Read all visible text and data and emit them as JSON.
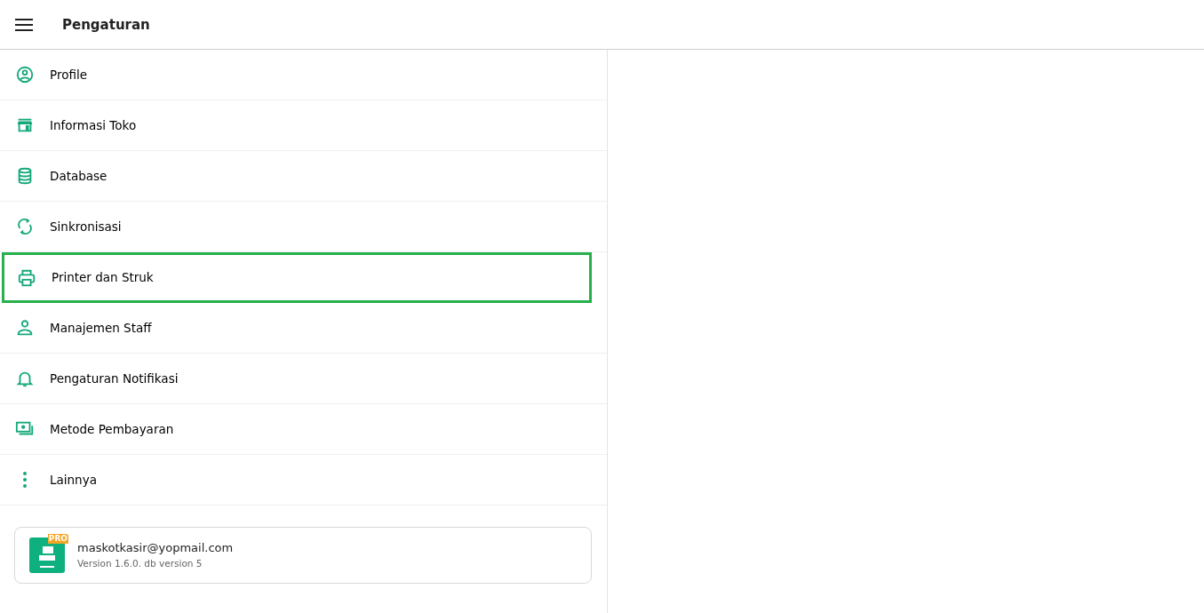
{
  "app_bar": {
    "title": "Pengaturan"
  },
  "menu": [
    {
      "label": "Profile",
      "kind": "profile",
      "selected": false
    },
    {
      "label": "Informasi Toko",
      "kind": "store",
      "selected": false
    },
    {
      "label": "Database",
      "kind": "database",
      "selected": false
    },
    {
      "label": "Sinkronisasi",
      "kind": "sync",
      "selected": false
    },
    {
      "label": "Printer dan Struk",
      "kind": "printer",
      "selected": true
    },
    {
      "label": "Manajemen Staff",
      "kind": "person",
      "selected": false
    },
    {
      "label": "Pengaturan Notifikasi",
      "kind": "bell",
      "selected": false
    },
    {
      "label": "Metode Pembayaran",
      "kind": "payment",
      "selected": false
    },
    {
      "label": "Lainnya",
      "kind": "more",
      "selected": false
    }
  ],
  "account": {
    "badge": "PRO",
    "email": "maskotkasir@yopmail.com",
    "version": "Version 1.6.0. db version 5"
  }
}
